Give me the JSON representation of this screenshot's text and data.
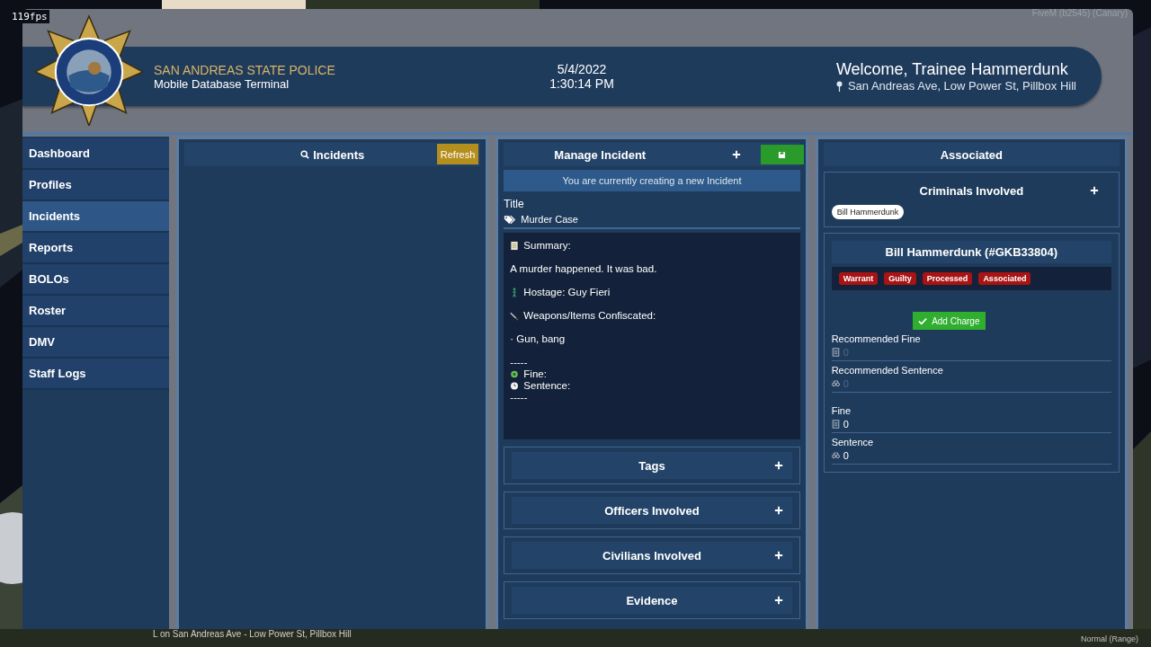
{
  "overlay": {
    "fps": "119fps",
    "build": "FiveM (b2545) (Canary)",
    "voice": "Normal (Range)",
    "street": "L on San Andreas Ave - Low Power St, Pillbox Hill"
  },
  "header": {
    "agency": "SAN ANDREAS STATE POLICE",
    "subtitle": "Mobile Database Terminal",
    "date": "5/4/2022",
    "time": "1:30:14 PM",
    "welcome": "Welcome, Trainee Hammerdunk",
    "location": "San Andreas Ave, Low Power St, Pillbox Hill"
  },
  "sidebar": {
    "items": [
      {
        "label": "Dashboard",
        "selected": false
      },
      {
        "label": "Profiles",
        "selected": false
      },
      {
        "label": "Incidents",
        "selected": true
      },
      {
        "label": "Reports",
        "selected": false
      },
      {
        "label": "BOLOs",
        "selected": false
      },
      {
        "label": "Roster",
        "selected": false
      },
      {
        "label": "DMV",
        "selected": false
      },
      {
        "label": "Staff Logs",
        "selected": false
      }
    ]
  },
  "incidents_panel": {
    "title": "Incidents",
    "refresh": "Refresh"
  },
  "manage": {
    "title": "Manage Incident",
    "notice": "You are currently creating a new Incident",
    "title_label": "Title",
    "title_value": "Murder Case",
    "summary": [
      {
        "kind": "note",
        "text": "Summary:"
      },
      {
        "kind": "text",
        "text": "A murder happened. It was bad."
      },
      {
        "kind": "hostage",
        "text": "Hostage: Guy Fieri"
      },
      {
        "kind": "weapons",
        "text": "Weapons/Items Confiscated:"
      },
      {
        "kind": "text",
        "text": "· Gun, bang"
      },
      {
        "kind": "divider",
        "text": "-----"
      },
      {
        "kind": "fine",
        "text": "Fine:"
      },
      {
        "kind": "sentence",
        "text": "Sentence:"
      },
      {
        "kind": "divider",
        "text": "-----"
      }
    ],
    "sections": [
      "Tags",
      "Officers Involved",
      "Civilians Involved",
      "Evidence"
    ]
  },
  "associated": {
    "title": "Associated",
    "criminals_title": "Criminals Involved",
    "criminals": [
      "Bill Hammerdunk"
    ],
    "record": {
      "name": "Bill Hammerdunk (#GKB33804)",
      "tags": [
        "Warrant",
        "Guilty",
        "Processed",
        "Associated"
      ],
      "add_charge": "Add Charge",
      "fields": [
        {
          "kind": "fine",
          "label": "Recommended Fine",
          "placeholder": "0"
        },
        {
          "kind": "sentence",
          "label": "Recommended Sentence",
          "placeholder": "0"
        },
        {
          "kind": "fine",
          "label": "Fine",
          "value": "0"
        },
        {
          "kind": "sentence",
          "label": "Sentence",
          "value": "0"
        }
      ]
    }
  }
}
